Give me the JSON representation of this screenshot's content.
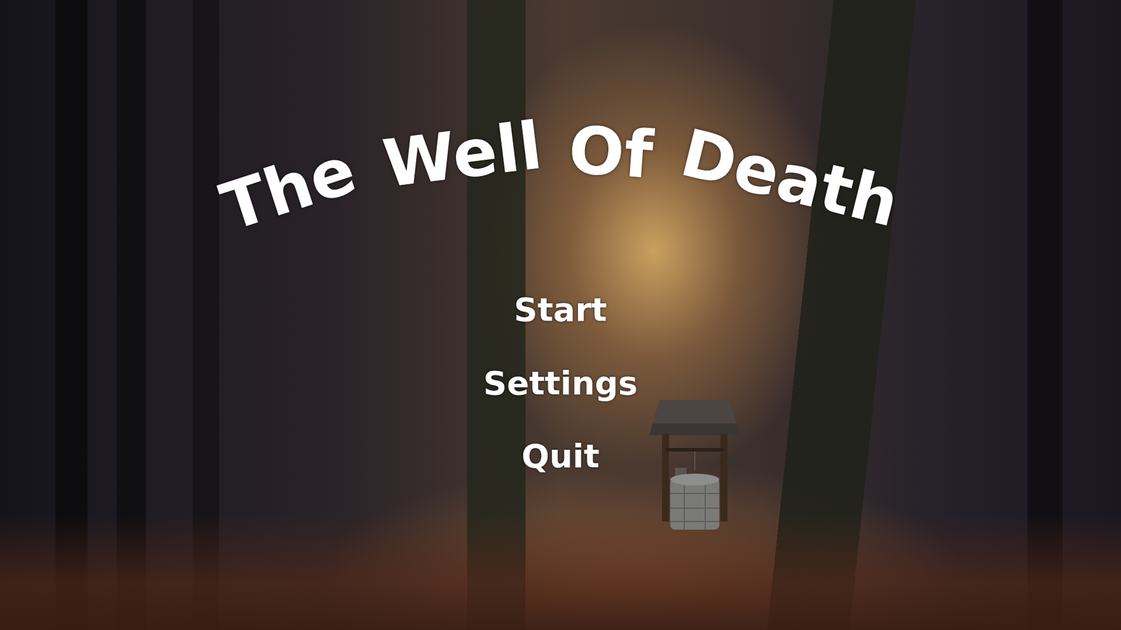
{
  "title_words": [
    "The",
    "Well",
    "Of",
    "Death"
  ],
  "menu": [
    "Start",
    "Settings",
    "Quit"
  ]
}
